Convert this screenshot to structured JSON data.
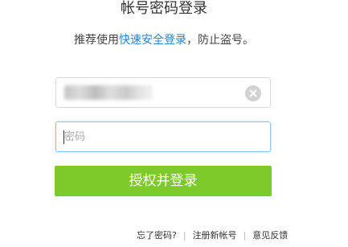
{
  "title": "帐号密码登录",
  "tip": {
    "prefix": "推荐使用",
    "link": "快速安全登录",
    "suffix": "，防止盗号。"
  },
  "account": {
    "value": "",
    "clear_icon": "clear-circle-icon"
  },
  "password": {
    "placeholder": "密码",
    "value": ""
  },
  "submit": {
    "label": "授权并登录"
  },
  "footer": {
    "forgot": "忘了密码?",
    "register": "注册新帐号",
    "feedback": "意见反馈",
    "separator": "|"
  },
  "colors": {
    "button": "#7dcb2b",
    "link": "#2c7fcf",
    "focus_border": "#8fc3ec"
  }
}
